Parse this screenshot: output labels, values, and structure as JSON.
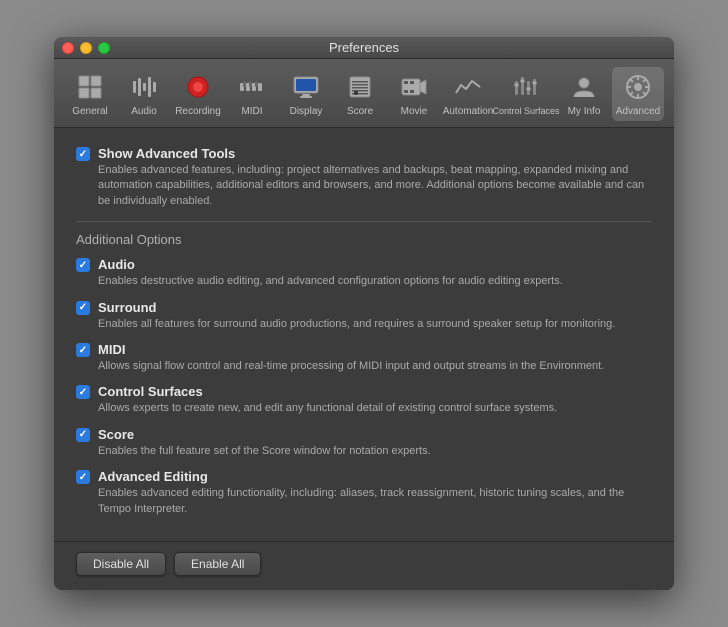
{
  "window": {
    "title": "Preferences"
  },
  "toolbar": {
    "items": [
      {
        "id": "general",
        "label": "General",
        "icon": "general"
      },
      {
        "id": "audio",
        "label": "Audio",
        "icon": "audio"
      },
      {
        "id": "recording",
        "label": "Recording",
        "icon": "recording"
      },
      {
        "id": "midi",
        "label": "MIDI",
        "icon": "midi"
      },
      {
        "id": "display",
        "label": "Display",
        "icon": "display"
      },
      {
        "id": "score",
        "label": "Score",
        "icon": "score"
      },
      {
        "id": "movie",
        "label": "Movie",
        "icon": "movie"
      },
      {
        "id": "automation",
        "label": "Automation",
        "icon": "automation"
      },
      {
        "id": "control-surfaces",
        "label": "Control Surfaces",
        "icon": "control-surfaces"
      },
      {
        "id": "my-info",
        "label": "My Info",
        "icon": "my-info"
      },
      {
        "id": "advanced",
        "label": "Advanced",
        "icon": "advanced",
        "active": true
      }
    ]
  },
  "main": {
    "show_advanced_tools": {
      "title": "Show Advanced Tools",
      "description": "Enables advanced features, including: project alternatives and backups, beat mapping, expanded mixing and automation capabilities, additional editors and browsers, and more. Additional options become available and can be individually enabled.",
      "checked": true
    },
    "additional_options_label": "Additional Options",
    "options": [
      {
        "id": "audio",
        "title": "Audio",
        "description": "Enables destructive audio editing, and advanced configuration options for audio editing experts.",
        "checked": true
      },
      {
        "id": "surround",
        "title": "Surround",
        "description": "Enables all features for surround audio productions, and requires a surround speaker setup for monitoring.",
        "checked": true
      },
      {
        "id": "midi",
        "title": "MIDI",
        "description": "Allows signal flow control and real-time processing of MIDI input and output streams in the Environment.",
        "checked": true
      },
      {
        "id": "control-surfaces",
        "title": "Control Surfaces",
        "description": "Allows experts to create new, and edit any functional detail of existing control surface systems.",
        "checked": true
      },
      {
        "id": "score",
        "title": "Score",
        "description": "Enables the full feature set of the Score window for notation experts.",
        "checked": true
      },
      {
        "id": "advanced-editing",
        "title": "Advanced Editing",
        "description": "Enables advanced editing functionality, including: aliases, track reassignment, historic tuning scales, and the Tempo Interpreter.",
        "checked": true
      }
    ]
  },
  "buttons": {
    "disable_all": "Disable All",
    "enable_all": "Enable All"
  }
}
